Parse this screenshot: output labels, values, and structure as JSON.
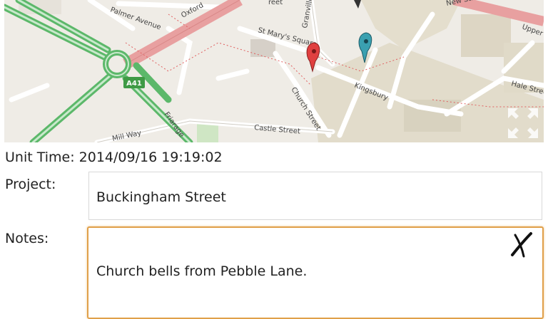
{
  "map": {
    "streets": {
      "palmer": "Palmer Avenue",
      "oxford": "Oxford",
      "stmarys": "St Mary's Square",
      "granville": "Granville",
      "church": "Church Street",
      "kingsbury": "Kingsbury",
      "castle": "Castle Street",
      "millway": "Mill Way",
      "friarage": "Friarage",
      "new": "New Street",
      "upper": "Upper",
      "hale": "Hale Street",
      "a41": "A41",
      "top": "reet"
    },
    "markers": [
      {
        "color": "#e04040",
        "name": "red-marker"
      },
      {
        "color": "#3aa0b0",
        "name": "teal-marker"
      }
    ]
  },
  "form": {
    "unit_time": "Unit Time: 2014/09/16 19:19:02",
    "project_label": "Project:",
    "project_value": "Buckingham  Street",
    "notes_label": "Notes:",
    "notes_value": "Church bells from Pebble Lane."
  },
  "colors": {
    "accent": "#e0a04a",
    "major_road": "#e8a0a0",
    "green_road": "#5cb86a"
  },
  "icons": {
    "clear": "clear-x-icon",
    "expand": "expand-map-icon"
  }
}
